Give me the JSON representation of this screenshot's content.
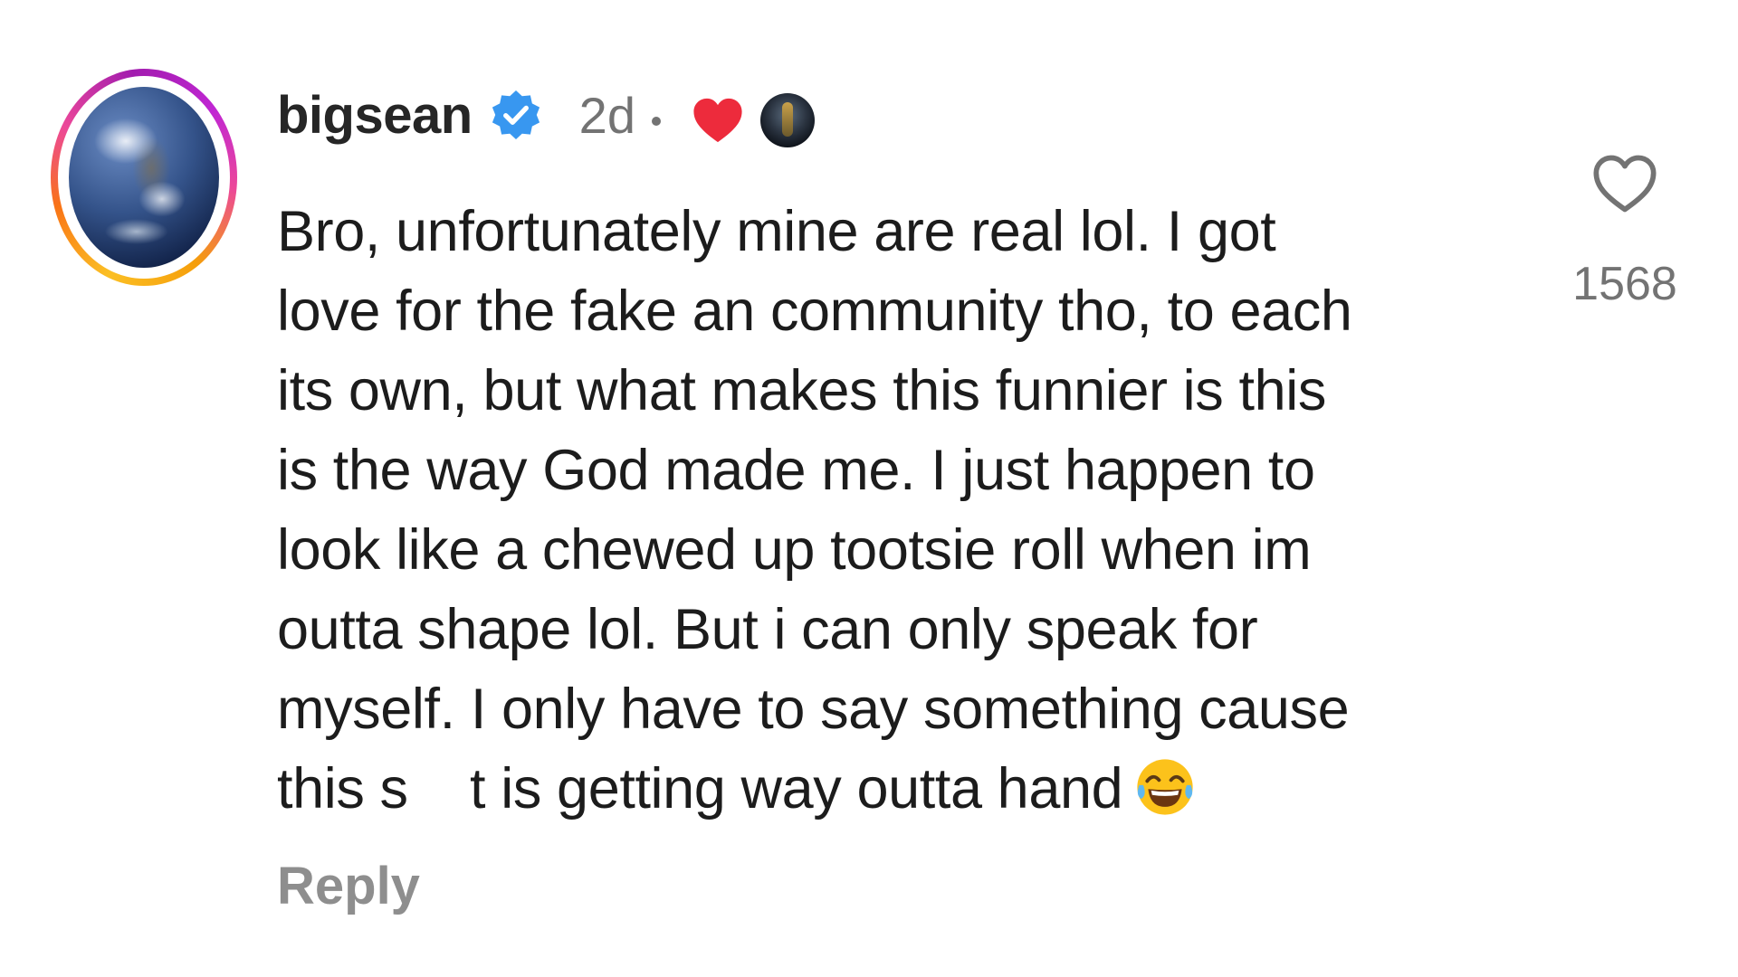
{
  "comment": {
    "username": "bigsean",
    "verified": true,
    "time": "2d",
    "creator_liked": true,
    "text_lines": [
      "Bro, unfortunately mine are real lol. I got",
      "love for the fake an community tho, to each",
      "its own, but what makes this funnier is this",
      "is the way God made me. I just happen to",
      "look like a chewed up tootsie roll when im",
      "outta shape lol. But i can only speak for",
      "myself. I only have to say something cause",
      "this s    t is getting way outta hand"
    ],
    "emoji": "face-with-tears-of-joy",
    "reply_label": "Reply",
    "like_count": "1568"
  },
  "icons": {
    "verified": "verified-badge-icon",
    "creator_heart": "heart-icon",
    "like": "heart-outline-icon"
  },
  "colors": {
    "verified_blue": "#3897f0",
    "heart_red": "#ed2b3c",
    "text_dark": "#1c1c1c",
    "text_muted": "#737373"
  }
}
